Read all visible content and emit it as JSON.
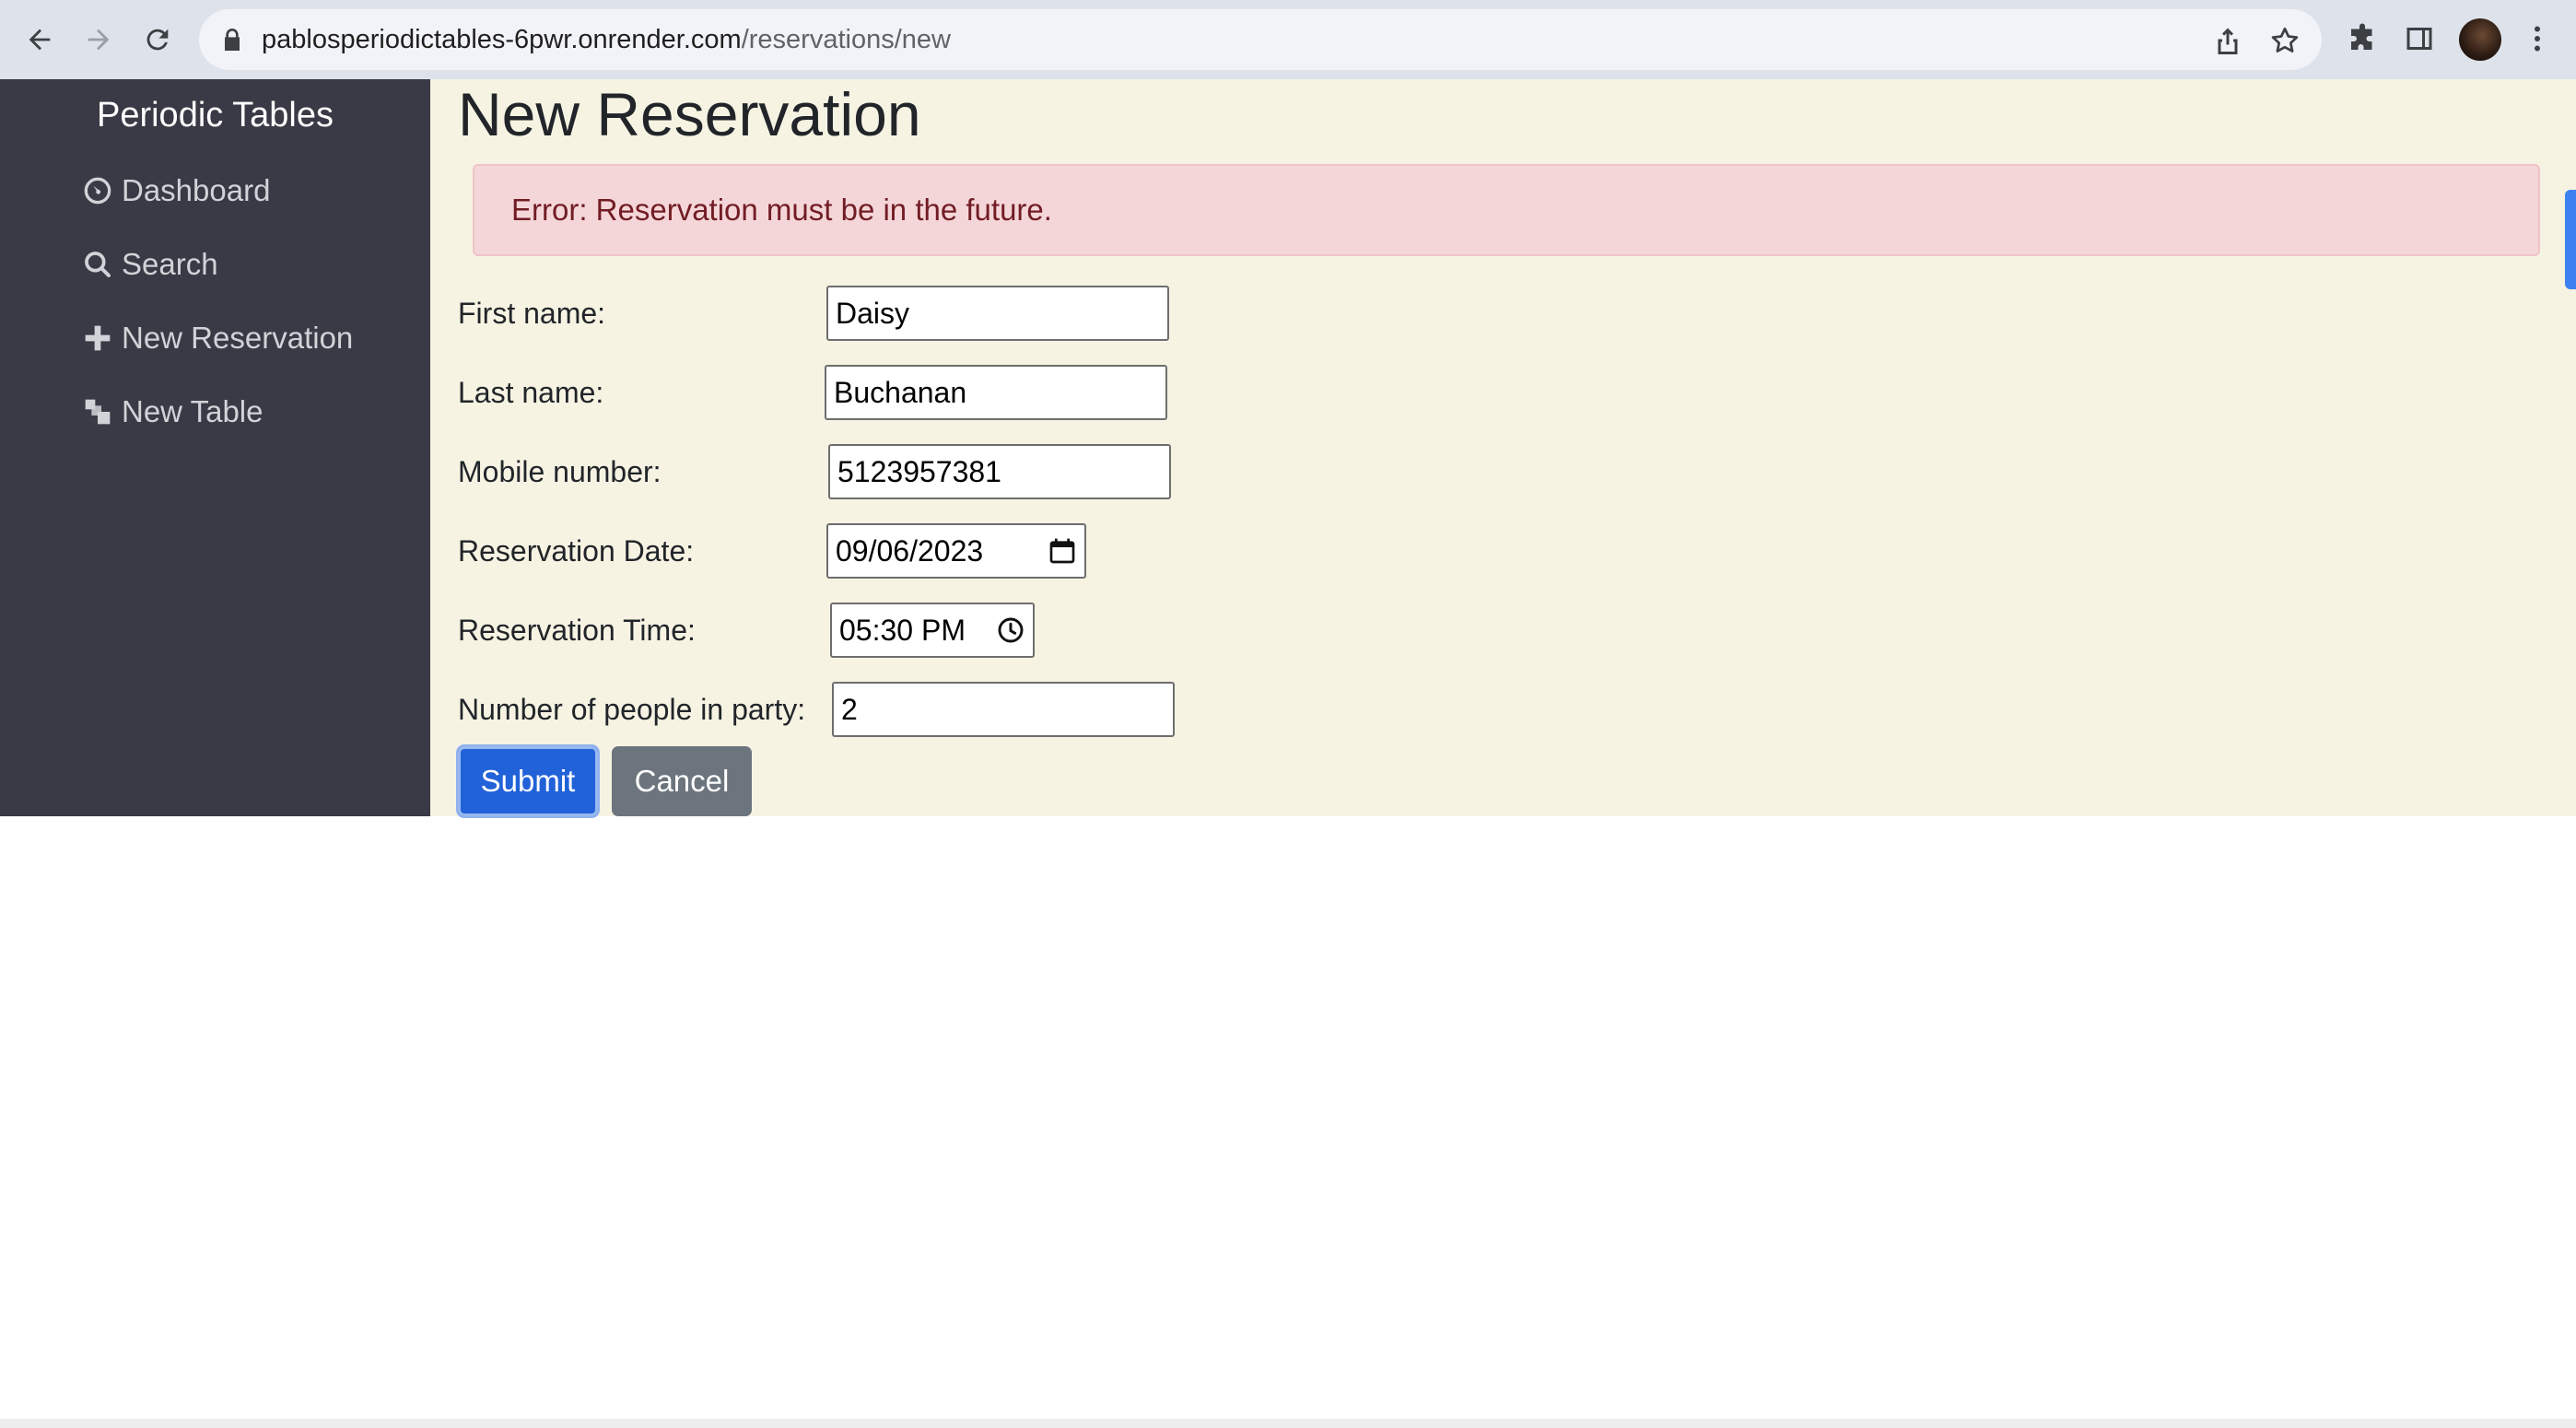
{
  "browser": {
    "url_host": "pablosperiodictables-6pwr.onrender.com",
    "url_path": "/reservations/new"
  },
  "sidebar": {
    "brand": "Periodic Tables",
    "items": [
      {
        "label": "Dashboard",
        "icon": "dashboard-icon"
      },
      {
        "label": "Search",
        "icon": "search-icon"
      },
      {
        "label": "New Reservation",
        "icon": "plus-icon"
      },
      {
        "label": "New Table",
        "icon": "layers-icon"
      }
    ]
  },
  "main": {
    "title": "New Reservation",
    "error": "Error: Reservation must be in the future.",
    "form": {
      "first_name_label": "First name:",
      "first_name_value": "Daisy",
      "last_name_label": "Last name:",
      "last_name_value": "Buchanan",
      "mobile_label": "Mobile number:",
      "mobile_value": "5123957381",
      "date_label": "Reservation Date:",
      "date_value": "09/06/2023",
      "time_label": "Reservation Time:",
      "time_value": "05:30 PM",
      "people_label": "Number of people in party:",
      "people_value": "2"
    },
    "buttons": {
      "submit": "Submit",
      "cancel": "Cancel"
    }
  },
  "colors": {
    "sidebar_bg": "#393a45",
    "content_bg": "#f6f3e3",
    "alert_bg": "#f4d6d9",
    "alert_text": "#721c24",
    "primary": "#2162d9",
    "secondary": "#6c757d"
  }
}
